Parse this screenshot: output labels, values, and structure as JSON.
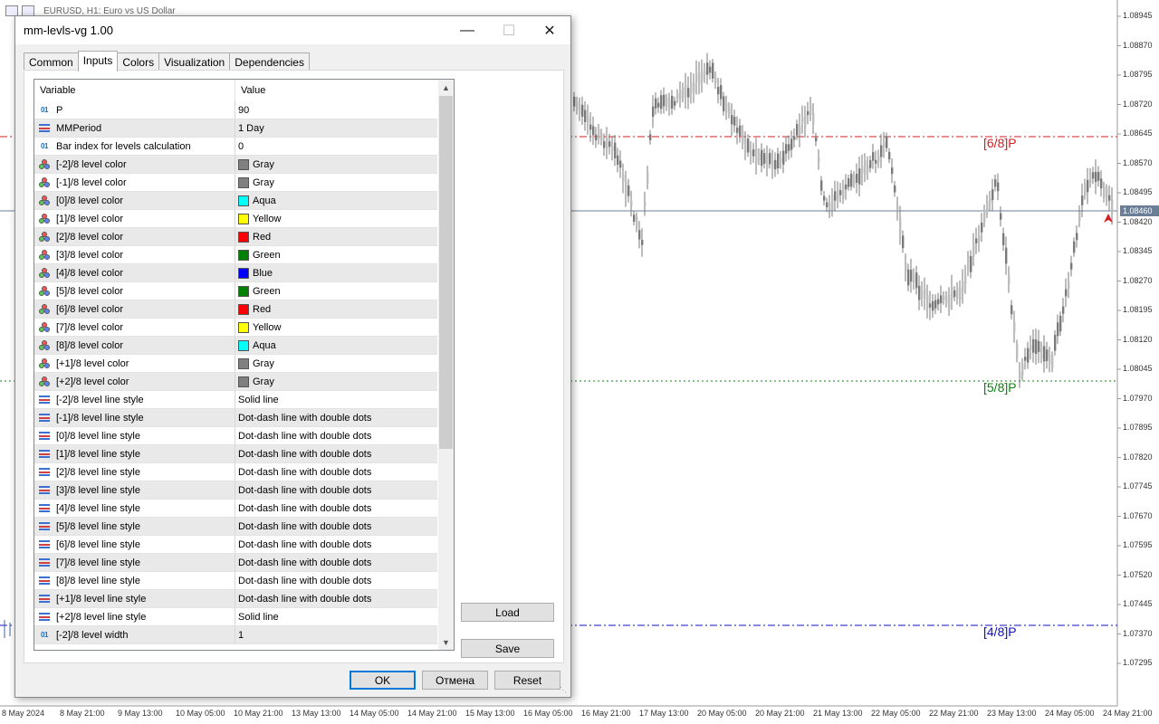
{
  "chart": {
    "title": "EURUSD, H1:  Euro vs US Dollar",
    "price_labels": [
      "1.08945",
      "1.08870",
      "1.08795",
      "1.08720",
      "1.08645",
      "1.08570",
      "1.08495",
      "1.08420",
      "1.08345",
      "1.08270",
      "1.08195",
      "1.08120",
      "1.08045",
      "1.07970",
      "1.07895",
      "1.07820",
      "1.07745",
      "1.07670",
      "1.07595",
      "1.07520",
      "1.07445",
      "1.07370",
      "1.07295"
    ],
    "current_price": "1.08460",
    "time_labels": [
      "8 May 2024",
      "8 May 21:00",
      "9 May 13:00",
      "10 May 05:00",
      "10 May 21:00",
      "13 May 13:00",
      "14 May 05:00",
      "14 May 21:00",
      "15 May 13:00",
      "16 May 05:00",
      "16 May 21:00",
      "17 May 13:00",
      "20 May 05:00",
      "20 May 21:00",
      "21 May 13:00",
      "22 May 05:00",
      "22 May 21:00",
      "23 May 13:00",
      "24 May 05:00",
      "24 May 21:00"
    ],
    "levels": [
      {
        "label": "[6/8]P",
        "color": "#d02020"
      },
      {
        "label": "[5/8]P",
        "color": "#108010"
      },
      {
        "label": "[4/8]P",
        "color": "#1010c0"
      }
    ],
    "candle_color": "#7a7a7a"
  },
  "dialog": {
    "title": "mm-levls-vg 1.00",
    "tabs": [
      "Common",
      "Inputs",
      "Colors",
      "Visualization",
      "Dependencies"
    ],
    "active_tab": "Inputs",
    "columns": {
      "variable": "Variable",
      "value": "Value"
    },
    "rows": [
      {
        "icon": "num",
        "name": "P",
        "value": "90"
      },
      {
        "icon": "enum",
        "name": "MMPeriod",
        "value": "1 Day"
      },
      {
        "icon": "num",
        "name": "Bar index for levels calculation",
        "value": "0"
      },
      {
        "icon": "color",
        "name": "[-2]/8 level color",
        "value": "Gray",
        "swatch": "#808080"
      },
      {
        "icon": "color",
        "name": "[-1]/8 level color",
        "value": "Gray",
        "swatch": "#808080"
      },
      {
        "icon": "color",
        "name": "[0]/8 level color",
        "value": "Aqua",
        "swatch": "#00ffff"
      },
      {
        "icon": "color",
        "name": "[1]/8 level color",
        "value": "Yellow",
        "swatch": "#ffff00"
      },
      {
        "icon": "color",
        "name": "[2]/8 level color",
        "value": "Red",
        "swatch": "#ff0000"
      },
      {
        "icon": "color",
        "name": "[3]/8 level color",
        "value": "Green",
        "swatch": "#008000"
      },
      {
        "icon": "color",
        "name": "[4]/8 level color",
        "value": "Blue",
        "swatch": "#0000ff"
      },
      {
        "icon": "color",
        "name": "[5]/8 level color",
        "value": "Green",
        "swatch": "#008000"
      },
      {
        "icon": "color",
        "name": "[6]/8 level color",
        "value": "Red",
        "swatch": "#ff0000"
      },
      {
        "icon": "color",
        "name": "[7]/8 level color",
        "value": "Yellow",
        "swatch": "#ffff00"
      },
      {
        "icon": "color",
        "name": "[8]/8 level color",
        "value": "Aqua",
        "swatch": "#00ffff"
      },
      {
        "icon": "color",
        "name": "[+1]/8 level color",
        "value": "Gray",
        "swatch": "#808080"
      },
      {
        "icon": "color",
        "name": "[+2]/8 level color",
        "value": "Gray",
        "swatch": "#808080"
      },
      {
        "icon": "enum",
        "name": "[-2]/8 level line style",
        "value": "Solid line"
      },
      {
        "icon": "enum",
        "name": "[-1]/8 level line style",
        "value": "Dot-dash line with double dots"
      },
      {
        "icon": "enum",
        "name": "[0]/8 level line style",
        "value": "Dot-dash line with double dots"
      },
      {
        "icon": "enum",
        "name": "[1]/8 level line style",
        "value": "Dot-dash line with double dots"
      },
      {
        "icon": "enum",
        "name": "[2]/8 level line style",
        "value": "Dot-dash line with double dots"
      },
      {
        "icon": "enum",
        "name": "[3]/8 level line style",
        "value": "Dot-dash line with double dots"
      },
      {
        "icon": "enum",
        "name": "[4]/8 level line style",
        "value": "Dot-dash line with double dots"
      },
      {
        "icon": "enum",
        "name": "[5]/8 level line style",
        "value": "Dot-dash line with double dots"
      },
      {
        "icon": "enum",
        "name": "[6]/8 level line style",
        "value": "Dot-dash line with double dots"
      },
      {
        "icon": "enum",
        "name": "[7]/8 level line style",
        "value": "Dot-dash line with double dots"
      },
      {
        "icon": "enum",
        "name": "[8]/8 level line style",
        "value": "Dot-dash line with double dots"
      },
      {
        "icon": "enum",
        "name": "[+1]/8 level line style",
        "value": "Dot-dash line with double dots"
      },
      {
        "icon": "enum",
        "name": "[+2]/8 level line style",
        "value": "Solid line"
      },
      {
        "icon": "num",
        "name": "[-2]/8 level width",
        "value": "1"
      }
    ],
    "buttons": {
      "load": "Load",
      "save": "Save",
      "ok": "OK",
      "cancel": "Отмена",
      "reset": "Reset"
    }
  }
}
